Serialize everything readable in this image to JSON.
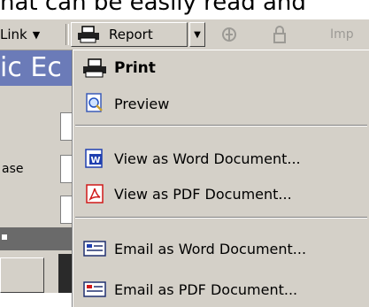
{
  "top_text": "hat can be easily read and",
  "toolbar": {
    "link_label": "Link",
    "report_label": "Report",
    "imp_label": "Imp"
  },
  "left_panel": {
    "title_fragment": "ic Ec",
    "ase_label": "ase"
  },
  "menu": {
    "items": [
      {
        "label": "Print",
        "icon": "printer-icon"
      },
      {
        "label": "Preview",
        "icon": "preview-icon"
      },
      {
        "label": "View as Word Document...",
        "icon": "word-doc-icon"
      },
      {
        "label": "View as PDF Document...",
        "icon": "pdf-doc-icon"
      },
      {
        "label": "Email as Word Document...",
        "icon": "email-word-icon"
      },
      {
        "label": "Email as PDF Document...",
        "icon": "email-pdf-icon"
      }
    ]
  },
  "colors": {
    "toolbar_bg": "#d4d0c8",
    "title_bar": "#6b7bb8",
    "word_blue": "#1f3fb0",
    "pdf_red": "#d01818"
  }
}
